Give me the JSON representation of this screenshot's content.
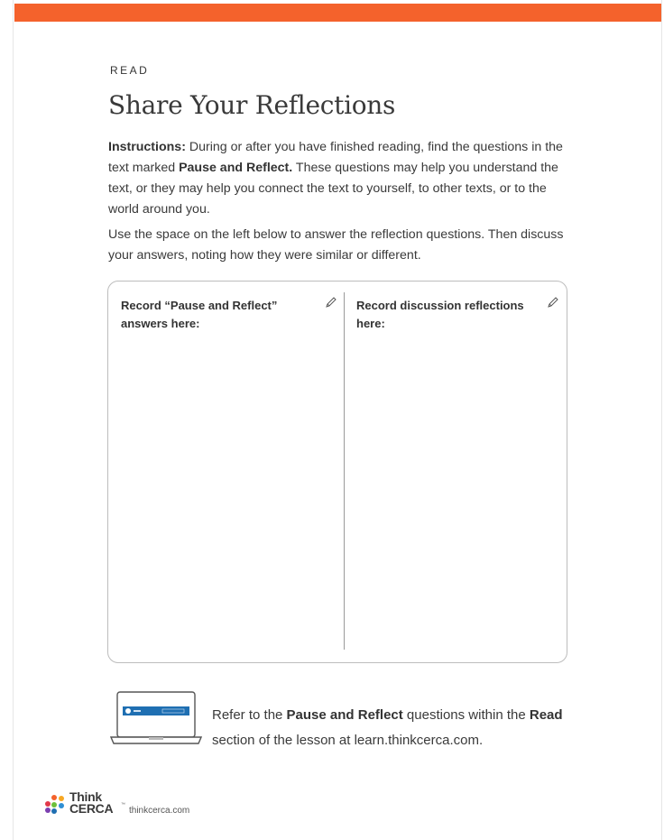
{
  "header": {
    "section": "READ",
    "title": "Share Your Reflections"
  },
  "instructions": {
    "label": "Instructions:",
    "text_1": " During or after you have finished reading, find the questions in the text marked ",
    "highlight": "Pause and Reflect.",
    "text_2": " These questions may help you understand the text, or they may help you connect the text to yourself, to other texts, or to the world around you."
  },
  "usage": {
    "text": "Use the space on the left below to answer the reflection questions. Then discuss your answers, noting how they were similar or different."
  },
  "response_box": {
    "left_label": "Record “Pause and Reflect” answers here:",
    "right_label": "Record discussion reflections here:",
    "left_icon": "pencil-icon",
    "right_icon": "pencil-icon"
  },
  "refer": {
    "text_1": "Refer to the ",
    "bold_1": "Pause and Reflect",
    "text_2": " questions within the ",
    "bold_2": "Read",
    "text_3": " section of the lesson at learn.thinkcerca.com.",
    "icon": "laptop-icon"
  },
  "footer": {
    "logo_line_1": "Think",
    "logo_line_2": "CERCA",
    "trademark": "™",
    "url": "thinkcerca.com"
  },
  "colors": {
    "accent": "#f4622c",
    "text": "#3a3a3a",
    "border": "#bdbdbd",
    "laptop_screen": "#1f6fb2"
  }
}
